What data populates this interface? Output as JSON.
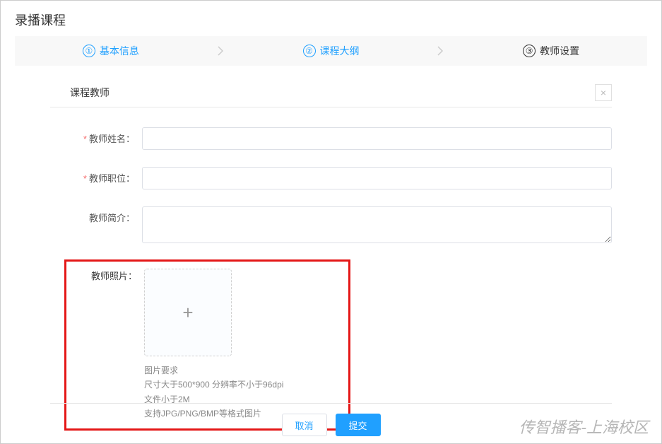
{
  "header": {
    "title": "录播课程"
  },
  "steps": {
    "items": [
      {
        "num": "①",
        "label": "基本信息",
        "state": "done"
      },
      {
        "num": "②",
        "label": "课程大纲",
        "state": "done"
      },
      {
        "num": "③",
        "label": "教师设置",
        "state": "active"
      }
    ]
  },
  "section": {
    "title": "课程教师",
    "close": "×"
  },
  "form": {
    "name_label": "教师姓名：",
    "title_label": "教师职位：",
    "intro_label": "教师简介：",
    "photo_label": "教师照片：",
    "name_value": "",
    "title_value": "",
    "intro_value": "",
    "hint_title": "图片要求",
    "hint_line1": "尺寸大于500*900 分辨率不小于96dpi",
    "hint_line2": "文件小于2M",
    "hint_line3": "支持JPG/PNG/BMP等格式图片"
  },
  "buttons": {
    "cancel": "取消",
    "submit": "提交"
  },
  "watermark": "传智播客-上海校区"
}
